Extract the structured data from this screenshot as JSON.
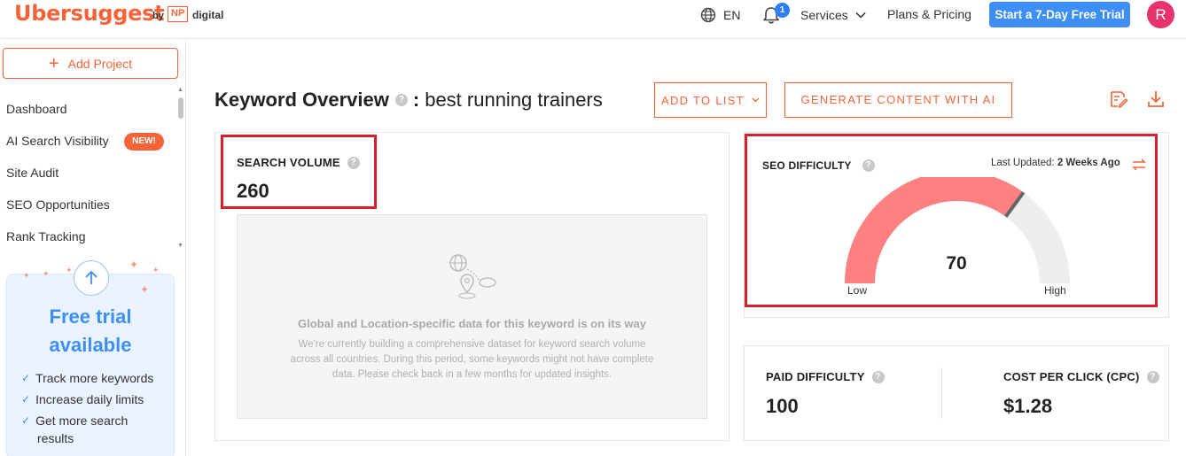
{
  "header": {
    "logo": "Ubersuggest",
    "logo_by": "by",
    "np_mark": "NP",
    "np_digital": "digital",
    "language": "EN",
    "notification_count": "1",
    "services_label": "Services",
    "plans_label": "Plans & Pricing",
    "trial_button": "Start a 7-Day Free Trial",
    "avatar_initial": "R"
  },
  "sidebar": {
    "add_project": "Add Project",
    "items": [
      {
        "label": "Dashboard"
      },
      {
        "label": "AI Search Visibility",
        "badge": "NEW!"
      },
      {
        "label": "Site Audit"
      },
      {
        "label": "SEO Opportunities"
      },
      {
        "label": "Rank Tracking"
      }
    ],
    "trial_card": {
      "title_line1": "Free trial",
      "title_line2": "available",
      "features": [
        "Track more keywords",
        "Increase daily limits",
        "Get more search",
        "results"
      ]
    }
  },
  "main": {
    "title": "Keyword Overview",
    "separator": ":",
    "keyword": "best running trainers",
    "add_to_list": "ADD TO LIST",
    "generate_content": "GENERATE CONTENT WITH AI",
    "search_volume": {
      "label": "SEARCH VOLUME",
      "value": "260"
    },
    "placeholder": {
      "title": "Global and Location-specific data for this keyword is on its way",
      "text": "We're currently building a comprehensive dataset for keyword search volume across all countries. During this period, some keywords might not have complete data. Please check back in a few months for updated insights."
    },
    "seo_difficulty": {
      "label": "SEO DIFFICULTY",
      "last_updated_label": "Last Updated:",
      "last_updated_value": "2 Weeks Ago",
      "value": "70",
      "gauge_fraction": 0.7,
      "low_label": "Low",
      "high_label": "High"
    },
    "paid_difficulty": {
      "label": "PAID DIFFICULTY",
      "value": "100"
    },
    "cpc": {
      "label": "COST PER CLICK (CPC)",
      "value": "$1.28"
    }
  },
  "colors": {
    "brand_orange": "#f56438",
    "primary_blue": "#3d8ff5",
    "gauge_fill": "#ff8080",
    "gauge_track": "#eeeeee",
    "highlight_red": "#d9202e"
  },
  "icons": [
    "globe-icon",
    "bell-icon",
    "chevron-down-icon",
    "plus-icon",
    "arrow-up-icon",
    "check-icon",
    "help-icon",
    "edit-icon",
    "download-icon",
    "refresh-icon",
    "location-map-icon"
  ]
}
